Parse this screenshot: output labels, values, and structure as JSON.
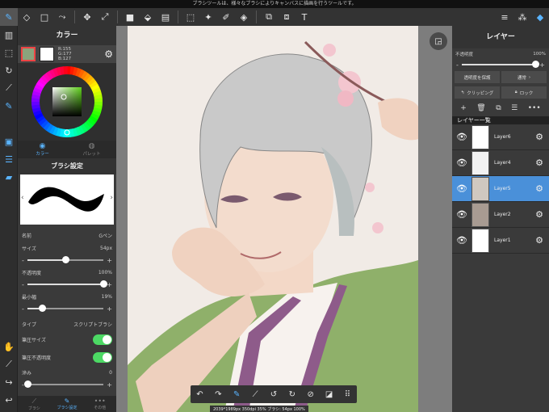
{
  "status_bar": {
    "text": "ブラシツールは、様々なブラシによりキャンバスに描画を行うツールです。"
  },
  "toolbar": {
    "items": [
      {
        "icon": "brush-icon",
        "glyph": "✎",
        "active": true
      },
      {
        "icon": "eraser-icon",
        "glyph": "◇"
      },
      {
        "icon": "rectangle-icon",
        "glyph": "□"
      },
      {
        "icon": "curve-icon",
        "glyph": "⤳"
      },
      {
        "icon": "move-icon",
        "glyph": "✥"
      },
      {
        "icon": "transform-icon",
        "glyph": "⤢"
      },
      {
        "icon": "fill-icon",
        "glyph": "■"
      },
      {
        "icon": "bucket-icon",
        "glyph": "⬙"
      },
      {
        "icon": "gradient-icon",
        "glyph": "▤"
      },
      {
        "icon": "select-icon",
        "glyph": "⬚"
      },
      {
        "icon": "magic-wand-icon",
        "glyph": "✦"
      },
      {
        "icon": "select-pen-icon",
        "glyph": "✐"
      },
      {
        "icon": "select-eraser-icon",
        "glyph": "◈"
      },
      {
        "icon": "copy-icon",
        "glyph": "⧉"
      },
      {
        "icon": "paste-icon",
        "glyph": "⧈"
      },
      {
        "icon": "text-icon",
        "glyph": "T"
      }
    ],
    "right": [
      {
        "icon": "menu-icon",
        "glyph": "≡"
      },
      {
        "icon": "material-icon",
        "glyph": "⁂"
      },
      {
        "icon": "layers-icon",
        "glyph": "◆"
      }
    ]
  },
  "left_rail": [
    {
      "icon": "pages-icon",
      "glyph": "▥"
    },
    {
      "icon": "selection-icon",
      "glyph": "⬚"
    },
    {
      "icon": "rotate-icon",
      "glyph": "↻"
    },
    {
      "icon": "ruler-icon",
      "glyph": "⟋"
    },
    {
      "icon": "snap-icon",
      "glyph": "✎",
      "blue": true
    },
    {
      "icon": "spacer",
      "glyph": ""
    },
    {
      "icon": "color-panel-icon",
      "glyph": "▣",
      "blue": true
    },
    {
      "icon": "brush-list-icon",
      "glyph": "☰",
      "blue": true
    },
    {
      "icon": "layer-panel-icon",
      "glyph": "▰",
      "blue": true
    }
  ],
  "left_rail_bottom": [
    {
      "icon": "hand-icon",
      "glyph": "✋"
    },
    {
      "icon": "eyedropper-icon",
      "glyph": "⟋"
    },
    {
      "icon": "redo-icon",
      "glyph": "↪"
    },
    {
      "icon": "undo-icon",
      "glyph": "↩"
    }
  ],
  "color_panel": {
    "title": "カラー",
    "primary_color": "#8aa47c",
    "secondary_color": "#ffffff",
    "r": "R:155",
    "g": "G:177",
    "b": "B:127",
    "tabs": [
      "カラー",
      "パレット"
    ]
  },
  "brush_panel": {
    "title": "ブラシ設定",
    "name_label": "名前",
    "name_value": "Gペン",
    "size_label": "サイズ",
    "size_value": "54px",
    "size_pct": 0.5,
    "opacity_label": "不透明度",
    "opacity_value": "100%",
    "opacity_pct": 1.0,
    "min_width_label": "最小幅",
    "min_width_value": "19%",
    "min_width_pct": 0.19,
    "type_label": "タイプ",
    "type_value": "スクリプトブラシ",
    "pressure_size_label": "筆圧サイズ",
    "pressure_opacity_label": "筆圧不透明度",
    "blur_label": "滲み",
    "blur_value": "0",
    "blur_pct": 0.0,
    "bottom_tabs": [
      "ブラシ",
      "ブラシ設定",
      "その他"
    ]
  },
  "canvas": {
    "status": "2039*1989px 350dpi 35% ブラシ: 54px 100%",
    "bottom_tools": [
      {
        "icon": "undo-icon",
        "glyph": "↶"
      },
      {
        "icon": "redo-icon",
        "glyph": "↷"
      },
      {
        "icon": "brush-size-icon",
        "glyph": "✎",
        "blue": true
      },
      {
        "icon": "eyedropper-icon",
        "glyph": "⟋"
      },
      {
        "icon": "rotate-left-icon",
        "glyph": "↺"
      },
      {
        "icon": "rotate-right-icon",
        "glyph": "↻"
      },
      {
        "icon": "reset-rotation-icon",
        "glyph": "⊘"
      },
      {
        "icon": "snapshot-icon",
        "glyph": "◪"
      },
      {
        "icon": "grid-icon",
        "glyph": "⠿"
      }
    ]
  },
  "layers_panel": {
    "title": "レイヤー",
    "opacity_label": "不透明度",
    "opacity_value": "100%",
    "protect_label": "透明度を保護",
    "blend_label": "通常",
    "clipping_label": "クリッピング",
    "lock_label": "ロック",
    "list_title": "レイヤー一覧",
    "layers": [
      {
        "name": "Layer6",
        "thumb": "#ffffff",
        "selected": false
      },
      {
        "name": "Layer4",
        "thumb": "#f2f2f2",
        "selected": false
      },
      {
        "name": "Layer5",
        "thumb": "#cfc8c0",
        "selected": true
      },
      {
        "name": "Layer2",
        "thumb": "#a89b92",
        "selected": false
      },
      {
        "name": "Layer1",
        "thumb": "#ffffff",
        "selected": false
      }
    ]
  }
}
